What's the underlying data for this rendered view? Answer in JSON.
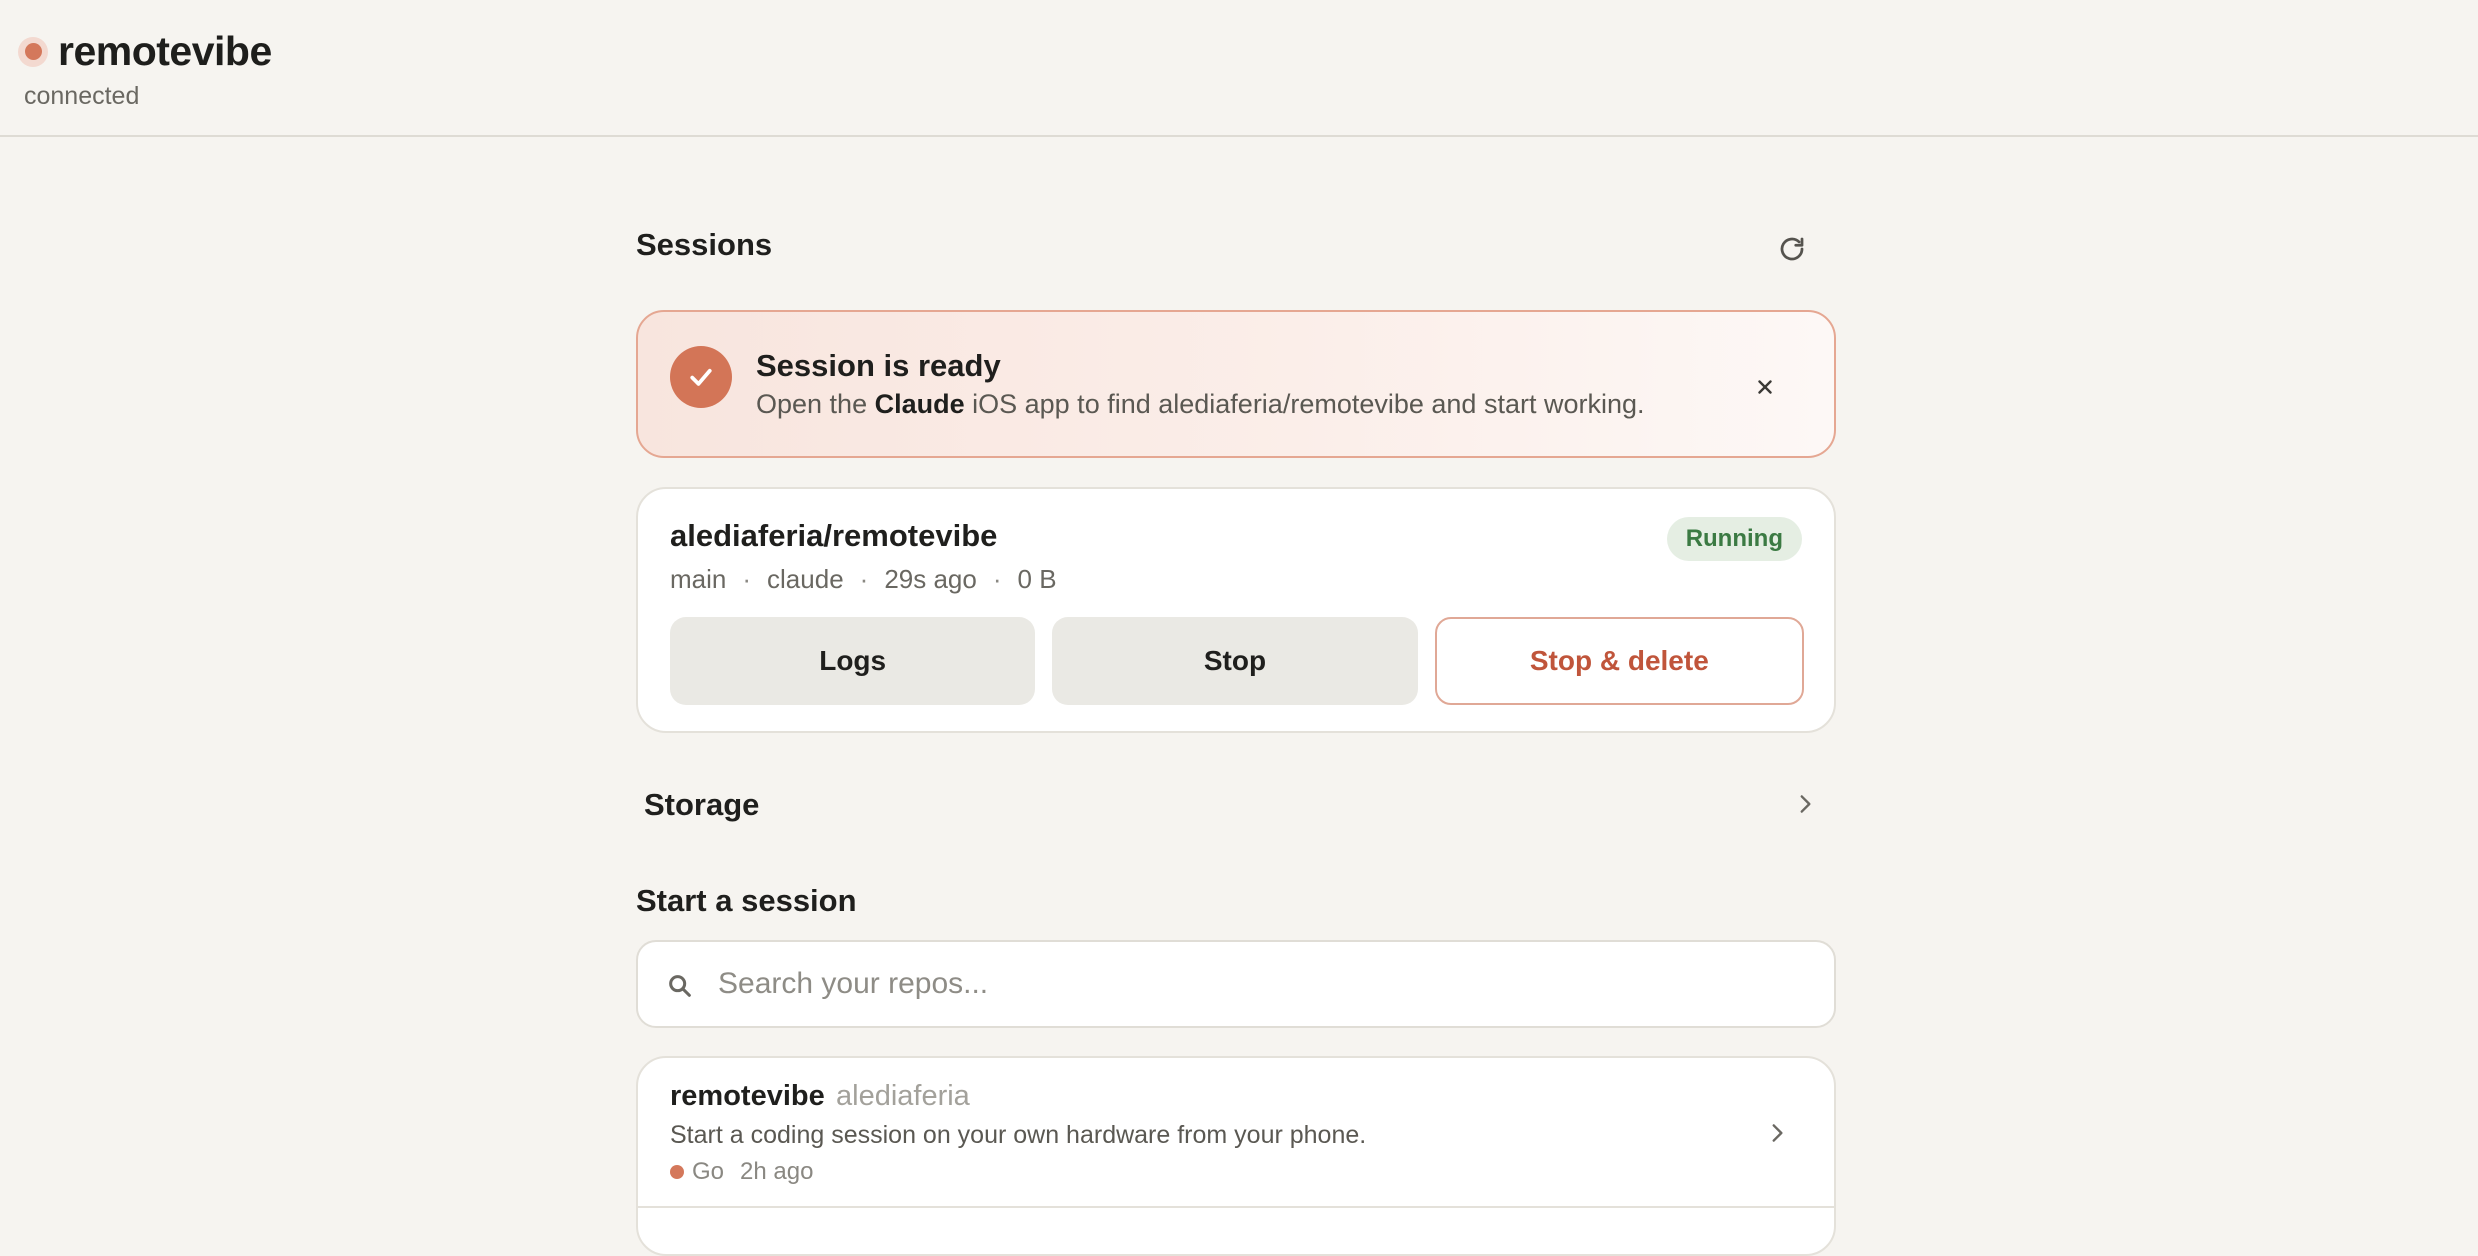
{
  "header": {
    "app_name": "remotevibe",
    "connection_status": "connected",
    "status_color": "#d4785b"
  },
  "sessions": {
    "title": "Sessions",
    "refresh_icon": "refresh-icon"
  },
  "banner": {
    "title": "Session is ready",
    "text_prefix": "Open the ",
    "text_bold": "Claude",
    "text_suffix": " iOS app to find alediaferia/remotevibe and start working.",
    "check_icon": "check-icon",
    "close_icon": "close-icon",
    "accent_color": "#d37557"
  },
  "session": {
    "repo": "alediaferia/remotevibe",
    "status": "Running",
    "status_color": "#3b7a43",
    "branch": "main",
    "agent": "claude",
    "started": "29s ago",
    "size": "0 B",
    "separator": "·",
    "actions": {
      "logs": "Logs",
      "stop": "Stop",
      "stop_delete": "Stop & delete"
    },
    "danger_color": "#c0553b"
  },
  "storage": {
    "label": "Storage",
    "chevron_icon": "chevron-right-icon"
  },
  "start": {
    "title": "Start a session",
    "search_placeholder": "Search your repos...",
    "search_value": "",
    "repos": [
      {
        "name": "remotevibe",
        "owner": "alediaferia",
        "description": "Start a coding session on your own hardware from your phone.",
        "language": "Go",
        "language_color": "#d4785b",
        "updated": "2h ago"
      }
    ]
  }
}
